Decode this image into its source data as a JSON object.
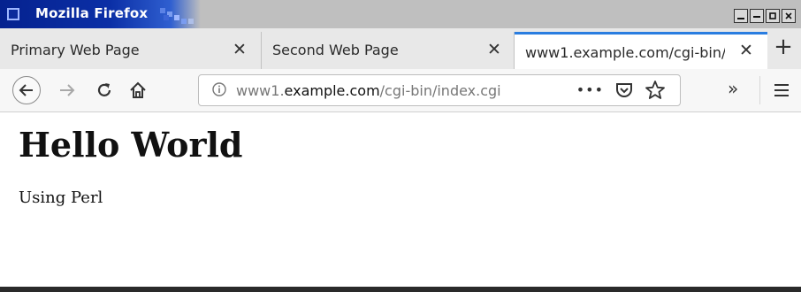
{
  "window": {
    "title": "Mozilla Firefox",
    "controls": [
      "minimize",
      "shade",
      "maximize",
      "close"
    ]
  },
  "tabs": [
    {
      "label": "Primary Web Page",
      "active": false
    },
    {
      "label": "Second Web Page",
      "active": false
    },
    {
      "label": "www1.example.com/cgi-bin/",
      "active": true
    }
  ],
  "toolbar": {
    "back_icon": "arrow-left-icon",
    "forward_icon": "arrow-right-icon",
    "reload_icon": "reload-icon",
    "home_icon": "home-icon",
    "overflow_label": "»",
    "menu_icon": "hamburger-icon"
  },
  "urlbar": {
    "prefix": "www1.",
    "domain": "example.com",
    "path": "/cgi-bin/index.cgi",
    "page_actions_label": "•••"
  },
  "page": {
    "heading": "Hello World",
    "paragraph": "Using Perl"
  },
  "colors": {
    "titlebar": "#0b2fa6",
    "active_tab_accent": "#2a7de0"
  }
}
